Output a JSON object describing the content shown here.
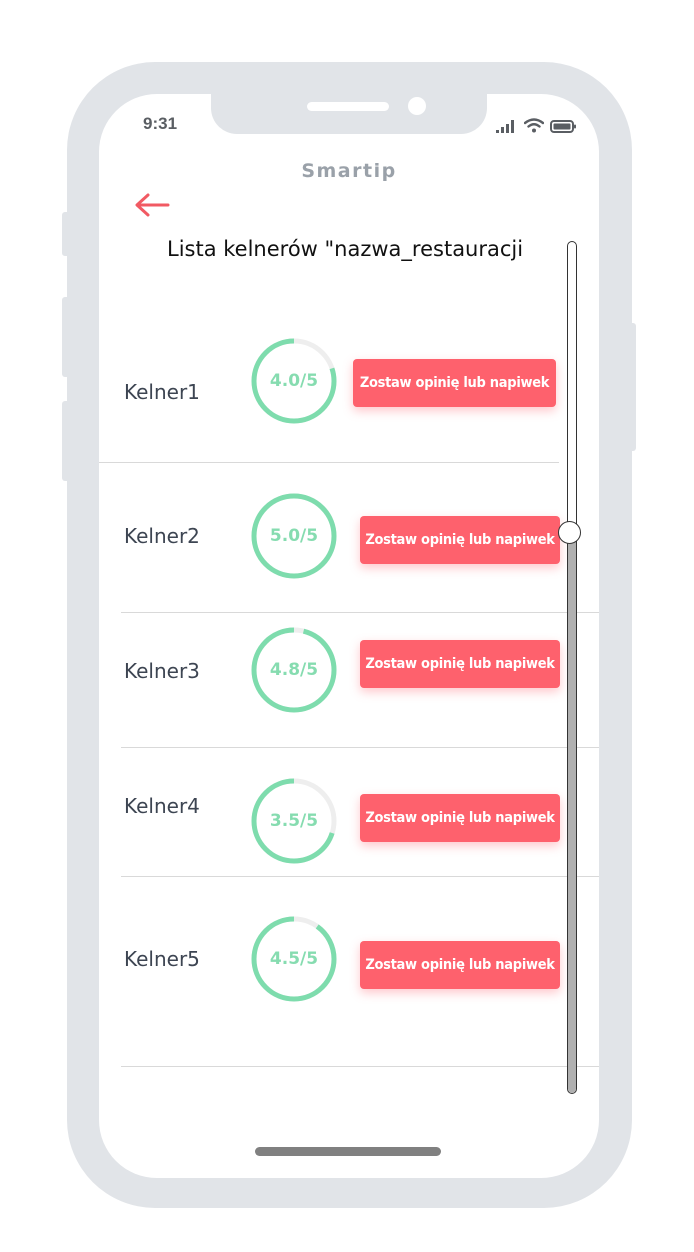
{
  "status_bar": {
    "time": "9:31",
    "icons": [
      "signal-icon",
      "wifi-icon",
      "battery-icon"
    ]
  },
  "app": {
    "title": "Smartip",
    "back_icon": "arrow-left-icon",
    "list_title": "Lista kelnerów \"nazwa_restauracji"
  },
  "waiters": [
    {
      "name": "Kelner1",
      "rating": 4.0,
      "rating_label": "4.0/5",
      "button_label": "Zostaw opinię lub napiwek"
    },
    {
      "name": "Kelner2",
      "rating": 5.0,
      "rating_label": "5.0/5",
      "button_label": "Zostaw opinię lub napiwek"
    },
    {
      "name": "Kelner3",
      "rating": 4.8,
      "rating_label": "4.8/5",
      "button_label": "Zostaw opinię lub napiwek"
    },
    {
      "name": "Kelner4",
      "rating": 3.5,
      "rating_label": "3.5/5",
      "button_label": "Zostaw opinię lub napiwek"
    },
    {
      "name": "Kelner5",
      "rating": 4.5,
      "rating_label": "4.5/5",
      "button_label": "Zostaw opinię lub napiwek"
    }
  ],
  "rating_max": 5,
  "scroll_position": 0.34,
  "colors": {
    "accent": "#fe616d",
    "rating_ring": "#7edcad",
    "rating_track": "#eeeeee",
    "frame": "#e1e4e8"
  }
}
